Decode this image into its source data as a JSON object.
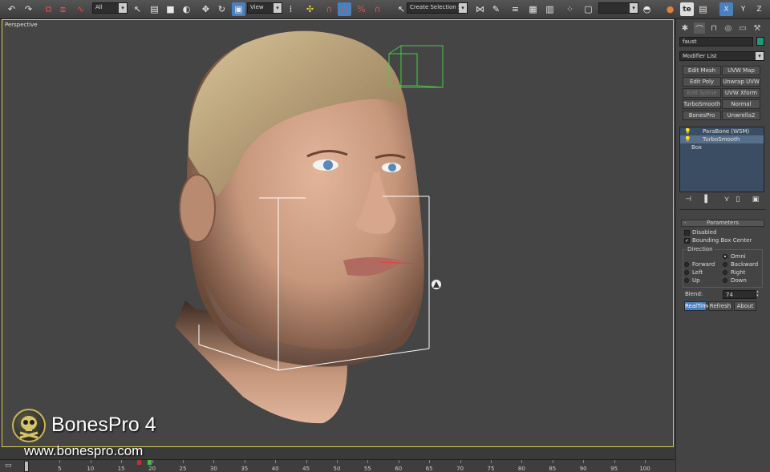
{
  "toolbar": {
    "selection_filter": "All",
    "view_mode": "View",
    "named_selection_placeholder": "Create Selection Se",
    "icons": [
      "undo-icon",
      "redo-icon",
      "select-link-icon",
      "unlink-icon",
      "bind-spacewarp-icon",
      "select-icon",
      "select-by-name-icon",
      "rect-region-icon",
      "window-crossing-icon",
      "move-icon",
      "rotate-icon",
      "scale-icon",
      "pivot-icon",
      "select-manipulate-icon",
      "snap-icon",
      "angle-snap-icon",
      "percent-snap-icon",
      "spinner-snap-icon",
      "edit-named-sets-icon",
      "mirror-icon",
      "align-icon",
      "layer-icon",
      "curve-editor-icon",
      "schematic-icon",
      "material-editor-icon",
      "render-setup-icon",
      "render-icon",
      "teapot-icon",
      "te-icon",
      "x-axis-icon",
      "y-axis-icon",
      "z-axis-icon"
    ],
    "te_label": "te",
    "axes": [
      "X",
      "Y",
      "Z"
    ]
  },
  "viewport": {
    "label": "Perspective",
    "border_color": "#d8d040",
    "background": "#454545"
  },
  "panel": {
    "object_name": "faust",
    "object_color": "#1e9a7a",
    "modifier_list_label": "Modifier List",
    "modifier_buttons": [
      [
        "Edit Mesh",
        "UVW Map"
      ],
      [
        "Edit Poly",
        "Unwrap UVW"
      ],
      [
        "Edit Spline",
        "UVW Xform"
      ],
      [
        "TurboSmooth",
        "Normal"
      ],
      [
        "BonesPro",
        "Unwrella2"
      ]
    ],
    "stack": [
      {
        "label": "ParaBone (WSM)",
        "bulb": true,
        "highlight": false
      },
      {
        "label": "TurboSmooth",
        "bulb": true,
        "highlight": true
      },
      {
        "label": "Box",
        "bulb": false,
        "highlight": false
      }
    ],
    "parameters": {
      "title": "Parameters",
      "disabled_label": "Disabled",
      "disabled_checked": false,
      "bbox_label": "Bounding Box Center",
      "bbox_checked": true,
      "direction_label": "Direction",
      "directions": [
        {
          "label": "Omni",
          "on": true
        },
        {
          "label": "Forward",
          "on": false
        },
        {
          "label": "Backward",
          "on": false
        },
        {
          "label": "Left",
          "on": false
        },
        {
          "label": "Right",
          "on": false
        },
        {
          "label": "Up",
          "on": false
        },
        {
          "label": "Down",
          "on": false
        }
      ],
      "blend_label": "Blend:",
      "blend_value": "74",
      "realtime_label": "RealTime",
      "refresh_label": "Refresh",
      "about_label": "About"
    }
  },
  "timeline": {
    "ticks": [
      "5",
      "10",
      "15",
      "20",
      "25",
      "30",
      "35",
      "40",
      "45",
      "50",
      "55",
      "60",
      "65",
      "70",
      "75",
      "80",
      "85",
      "90",
      "95",
      "100"
    ]
  },
  "brand": {
    "title": "BonesPro 4",
    "url": "www.bonespro.com"
  }
}
